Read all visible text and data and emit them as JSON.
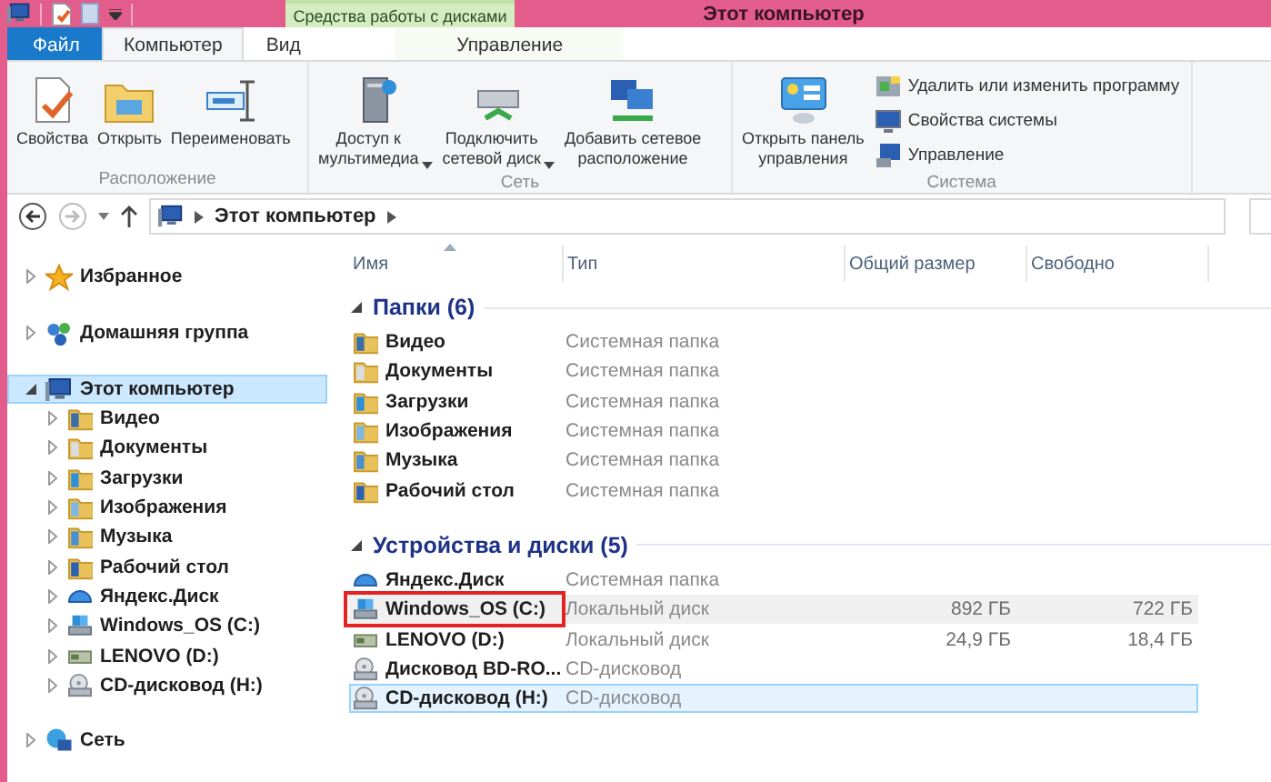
{
  "window": {
    "title": "Этот компьютер"
  },
  "contextual_tab": {
    "label": "Средства работы с дисками"
  },
  "tabs": [
    {
      "label": "Файл",
      "kind": "file",
      "selected": false
    },
    {
      "label": "Компьютер",
      "kind": "normal",
      "selected": true
    },
    {
      "label": "Вид",
      "kind": "normal",
      "selected": false
    },
    {
      "label": "Управление",
      "kind": "contextual",
      "selected": false
    }
  ],
  "ribbon": {
    "groups": [
      {
        "label": "Расположение",
        "buttons": [
          {
            "label": "Свойства",
            "kind": "large",
            "dropdown": false
          },
          {
            "label": "Открыть",
            "kind": "large",
            "dropdown": false
          },
          {
            "label": "Переименовать",
            "kind": "large",
            "dropdown": false
          }
        ]
      },
      {
        "label": "Сеть",
        "buttons": [
          {
            "label": "Доступ к\nмультимедиа",
            "kind": "large",
            "dropdown": true
          },
          {
            "label": "Подключить\nсетевой диск",
            "kind": "large",
            "dropdown": true
          },
          {
            "label": "Добавить сетевое\nрасположение",
            "kind": "large",
            "dropdown": false
          }
        ]
      },
      {
        "label": "Система",
        "buttons": [
          {
            "label": "Открыть панель\nуправления",
            "kind": "large",
            "dropdown": false
          },
          {
            "label": "Удалить или изменить программу",
            "kind": "small",
            "dropdown": false
          },
          {
            "label": "Свойства системы",
            "kind": "small",
            "dropdown": false
          },
          {
            "label": "Управление",
            "kind": "small",
            "dropdown": false
          }
        ]
      }
    ]
  },
  "address_bar": {
    "path": [
      "Этот компьютер"
    ]
  },
  "nav": {
    "items": [
      {
        "label": "Избранное",
        "expanded": false,
        "selected": false
      },
      {
        "label": "Домашняя группа",
        "expanded": false,
        "selected": false
      },
      {
        "label": "Этот компьютер",
        "expanded": true,
        "selected": true,
        "children": [
          {
            "label": "Видео",
            "expanded": false,
            "selected": false
          },
          {
            "label": "Документы",
            "expanded": false,
            "selected": false
          },
          {
            "label": "Загрузки",
            "expanded": false,
            "selected": false
          },
          {
            "label": "Изображения",
            "expanded": false,
            "selected": false
          },
          {
            "label": "Музыка",
            "expanded": false,
            "selected": false
          },
          {
            "label": "Рабочий стол",
            "expanded": false,
            "selected": false
          },
          {
            "label": "Яндекс.Диск",
            "expanded": false,
            "selected": false
          },
          {
            "label": "Windows_OS (C:)",
            "expanded": false,
            "selected": false
          },
          {
            "label": "LENOVO (D:)",
            "expanded": false,
            "selected": false
          },
          {
            "label": "CD-дисковод (H:)",
            "expanded": false,
            "selected": false
          }
        ]
      },
      {
        "label": "Сеть",
        "expanded": false,
        "selected": false
      }
    ]
  },
  "table": {
    "columns": [
      {
        "label": "Имя",
        "sorted": true
      },
      {
        "label": "Тип",
        "sorted": false
      },
      {
        "label": "Общий размер",
        "sorted": false
      },
      {
        "label": "Свободно",
        "sorted": false
      }
    ],
    "groups": [
      {
        "title": "Папки (6)",
        "expanded": true,
        "items": [
          {
            "name": "Видео",
            "type": "Системная папка",
            "selected": false,
            "hovered": false,
            "annotated": false
          },
          {
            "name": "Документы",
            "type": "Системная папка",
            "selected": false,
            "hovered": false,
            "annotated": false
          },
          {
            "name": "Загрузки",
            "type": "Системная папка",
            "selected": false,
            "hovered": false,
            "annotated": false
          },
          {
            "name": "Изображения",
            "type": "Системная папка",
            "selected": false,
            "hovered": false,
            "annotated": false
          },
          {
            "name": "Музыка",
            "type": "Системная папка",
            "selected": false,
            "hovered": false,
            "annotated": false
          },
          {
            "name": "Рабочий стол",
            "type": "Системная папка",
            "selected": false,
            "hovered": false,
            "annotated": false
          }
        ]
      },
      {
        "title": "Устройства и диски (5)",
        "expanded": true,
        "items": [
          {
            "name": "Яндекс.Диск",
            "type": "Системная папка",
            "selected": false,
            "hovered": false,
            "annotated": false
          },
          {
            "name": "Windows_OS (C:)",
            "type": "Локальный диск",
            "size": "892 ГБ",
            "free": "722 ГБ",
            "selected": false,
            "hovered": true,
            "annotated": true
          },
          {
            "name": "LENOVO (D:)",
            "type": "Локальный диск",
            "size": "24,9 ГБ",
            "free": "18,4 ГБ",
            "selected": false,
            "hovered": false,
            "annotated": false
          },
          {
            "name": "Дисковод BD-RO...",
            "type": "CD-дисковод",
            "selected": false,
            "hovered": false,
            "annotated": false
          },
          {
            "name": "CD-дисковод (H:)",
            "type": "CD-дисковод",
            "selected": true,
            "hovered": false,
            "annotated": false
          }
        ]
      }
    ]
  }
}
